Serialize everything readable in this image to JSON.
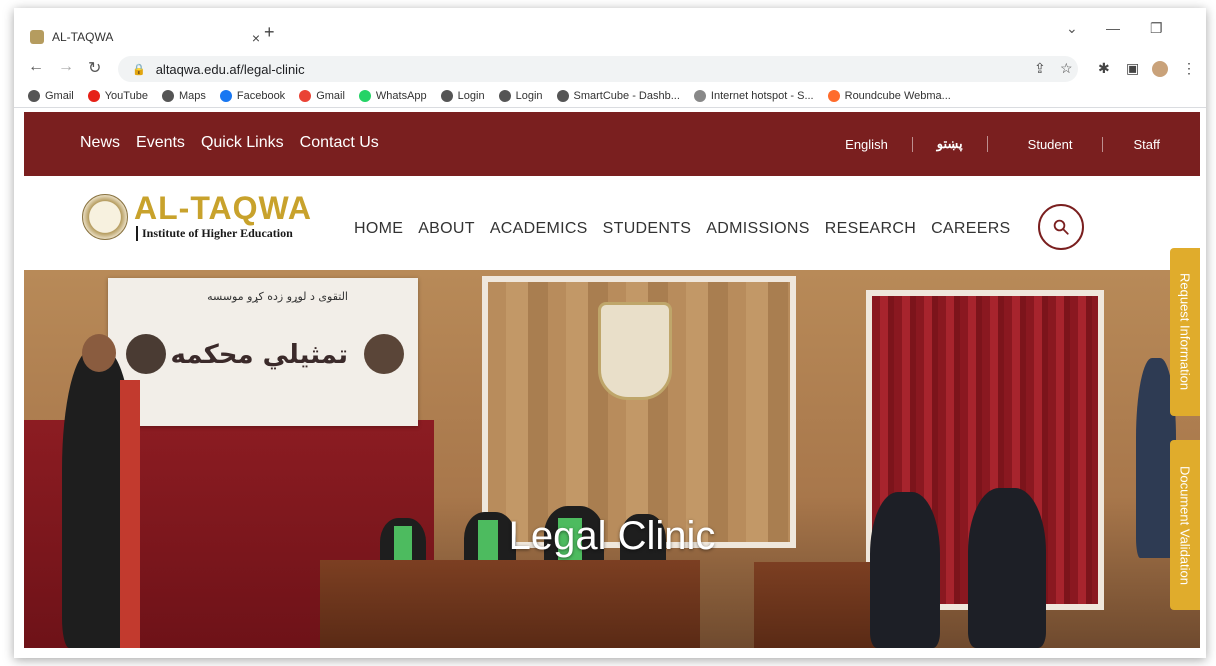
{
  "browser": {
    "tab_title": "AL-TAQWA",
    "tab_close": "×",
    "new_tab": "+",
    "url": "altaqwa.edu.af/legal-clinic",
    "bookmarks": [
      {
        "label": "Gmail",
        "icon": "globe-icon",
        "color": "#555555"
      },
      {
        "label": "YouTube",
        "icon": "youtube-icon",
        "color": "#e62117"
      },
      {
        "label": "Maps",
        "icon": "globe-icon",
        "color": "#555555"
      },
      {
        "label": "Facebook",
        "icon": "facebook-icon",
        "color": "#1877f2"
      },
      {
        "label": "Gmail",
        "icon": "gmail-icon",
        "color": "#ea4335"
      },
      {
        "label": "WhatsApp",
        "icon": "whatsapp-icon",
        "color": "#25d366"
      },
      {
        "label": "Login",
        "icon": "globe-icon",
        "color": "#555555"
      },
      {
        "label": "Login",
        "icon": "globe-icon",
        "color": "#555555"
      },
      {
        "label": "SmartCube - Dashb...",
        "icon": "globe-icon",
        "color": "#555555"
      },
      {
        "label": "Internet hotspot - S...",
        "icon": "hotspot-icon",
        "color": "#888888"
      },
      {
        "label": "Roundcube Webma...",
        "icon": "cpanel-icon",
        "color": "#ff6c2c"
      }
    ]
  },
  "site": {
    "top_links": [
      "News",
      "Events",
      "Quick Links",
      "Contact Us"
    ],
    "lang_english": "English",
    "lang_pashto": "پښتو",
    "student": "Student",
    "staff": "Staff",
    "logo_name": "AL-TAQWA",
    "logo_sub": "Institute of Higher Education",
    "nav": [
      "HOME",
      "ABOUT",
      "ACADEMICS",
      "STUDENTS",
      "ADMISSIONS",
      "RESEARCH",
      "CAREERS"
    ],
    "hero_title": "Legal Clinic",
    "banner_line1": "التقوی د لوړو زده کړو موسسه",
    "banner_line2": "تمثيلي محکمه",
    "side_request": "Request Information",
    "side_document": "Document Validation"
  },
  "colors": {
    "brand_maroon": "#7a1f1f",
    "brand_gold": "#c8a22c",
    "side_tab": "#e0ac2c"
  }
}
